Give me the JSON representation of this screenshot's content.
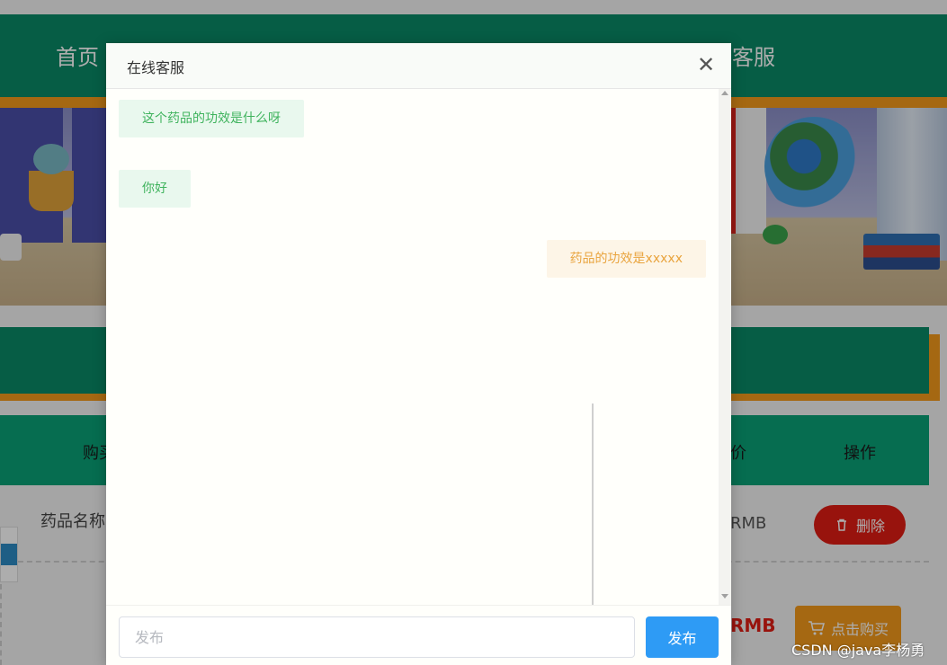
{
  "nav": {
    "home": "首页",
    "service_partial": "线客服"
  },
  "table": {
    "header_buy_partial": "购买",
    "header_price_partial": "价",
    "header_operation": "操作",
    "rows": [
      {
        "name_partial": "药品名称",
        "price_partial": "RMB",
        "action": "删除",
        "action_icon": "trash-icon"
      },
      {
        "price_partial": "RMB",
        "action": "点击购买",
        "action_icon": "cart-icon"
      }
    ]
  },
  "dialog": {
    "title": "在线客服",
    "close_icon": "close-icon",
    "messages": [
      {
        "side": "received",
        "text": "这个药品的功效是什么呀"
      },
      {
        "side": "received",
        "text": "你好"
      },
      {
        "side": "sent",
        "text": "药品的功效是xxxxx"
      }
    ],
    "composer": {
      "placeholder": "发布",
      "value": "",
      "send_label": "发布"
    }
  },
  "watermark": "CSDN @java李杨勇",
  "colors": {
    "primary_green": "#0a8a66",
    "accent_orange": "#f39a1b",
    "danger_red": "#e01c14",
    "send_blue": "#2e9bf5",
    "received_text": "#3fb35d",
    "sent_text": "#e9a43e"
  }
}
